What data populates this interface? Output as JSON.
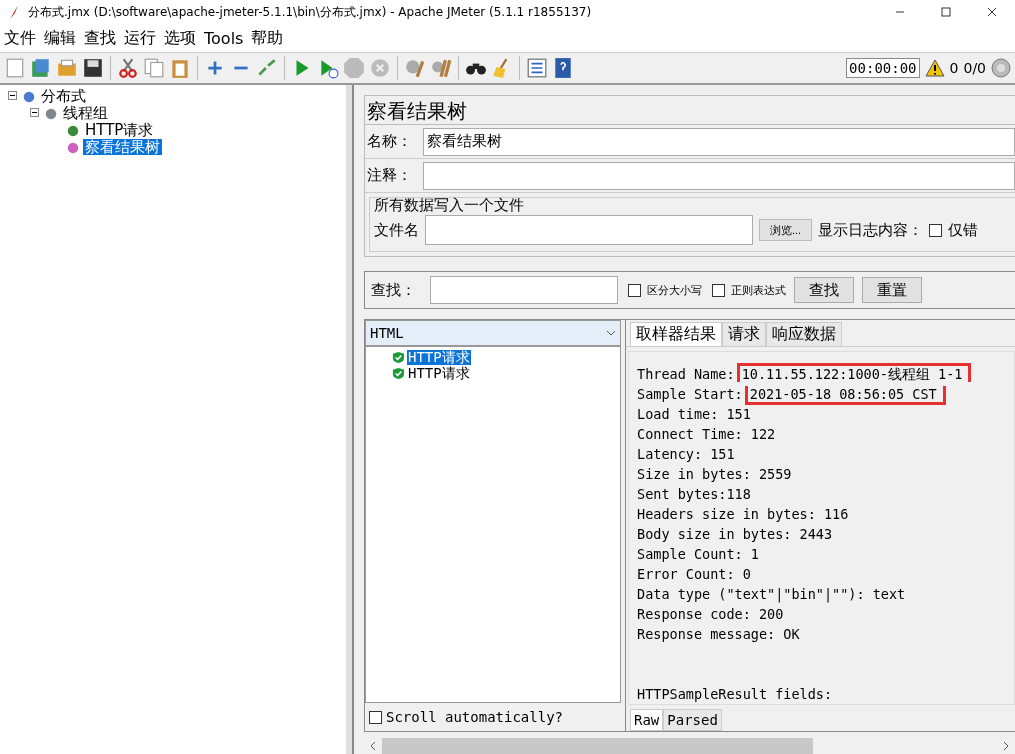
{
  "window": {
    "title": "分布式.jmx (D:\\software\\apache-jmeter-5.1.1\\bin\\分布式.jmx) - Apache JMeter (5.1.1 r1855137)"
  },
  "menu": [
    "文件",
    "编辑",
    "查找",
    "运行",
    "选项",
    "Tools",
    "帮助"
  ],
  "status": {
    "timer": "00:00:00",
    "warnings": "0",
    "threads": "0/0"
  },
  "tree": [
    {
      "label": "分布式",
      "kind": "plan",
      "expanded": true,
      "selected": false,
      "children": [
        {
          "label": "线程组",
          "kind": "group",
          "expanded": true,
          "selected": false,
          "children": [
            {
              "label": "HTTP请求",
              "kind": "sampler",
              "selected": false
            },
            {
              "label": "察看结果树",
              "kind": "listener",
              "selected": true
            }
          ]
        }
      ]
    }
  ],
  "panel": {
    "title": "察看结果树",
    "name_label": "名称：",
    "name_value": "察看结果树",
    "comment_label": "注释：",
    "file_group": "所有数据写入一个文件",
    "file_label": "文件名",
    "browse": "浏览...",
    "log_label": "显示日志内容：",
    "errors_only": {
      "label": "仅错",
      "checked": false
    }
  },
  "search": {
    "label": "查找：",
    "case": {
      "label": "区分大小写",
      "checked": false
    },
    "regex": {
      "label": "正则表达式",
      "checked": false
    },
    "find": "查找",
    "reset": "重置"
  },
  "renderer": "HTML",
  "samples": [
    {
      "label": "HTTP请求",
      "selected": true
    },
    {
      "label": "HTTP请求",
      "selected": false
    }
  ],
  "scroll_auto": {
    "label": "Scroll automatically?",
    "checked": false
  },
  "tabs": [
    {
      "label": "取样器结果",
      "selected": true
    },
    {
      "label": "请求",
      "selected": false
    },
    {
      "label": "响应数据",
      "selected": false
    }
  ],
  "lines": [
    {
      "label": "Thread Name: ",
      "value": "10.11.55.122:1000-线程组 1-1",
      "boxed": true
    },
    {
      "label": "Sample Start: ",
      "value": "2021-05-18 08:56:05 CST",
      "boxed": true
    },
    {
      "label": "Load time: ",
      "value": "151",
      "boxed": false
    },
    {
      "label": "Connect Time: ",
      "value": "122",
      "boxed": false
    },
    {
      "label": "Latency: ",
      "value": "151",
      "boxed": false
    },
    {
      "label": "Size in bytes: ",
      "value": "2559",
      "boxed": false
    },
    {
      "label": "Sent bytes:",
      "value": "118",
      "boxed": false
    },
    {
      "label": "Headers size in bytes: ",
      "value": "116",
      "boxed": false
    },
    {
      "label": "Body size in bytes: ",
      "value": "2443",
      "boxed": false
    },
    {
      "label": "Sample Count: ",
      "value": "1",
      "boxed": false
    },
    {
      "label": "Error Count: ",
      "value": "0",
      "boxed": false
    },
    {
      "label": "Data type (\"text\"|\"bin\"|\"\"): ",
      "value": "text",
      "boxed": false
    },
    {
      "label": "Response code: ",
      "value": "200",
      "boxed": false
    },
    {
      "label": "Response message: ",
      "value": "OK",
      "boxed": false
    }
  ],
  "fields_heading": "HTTPSampleResult fields:",
  "view_tabs": [
    {
      "label": "Raw",
      "selected": true
    },
    {
      "label": "Parsed",
      "selected": false
    }
  ]
}
